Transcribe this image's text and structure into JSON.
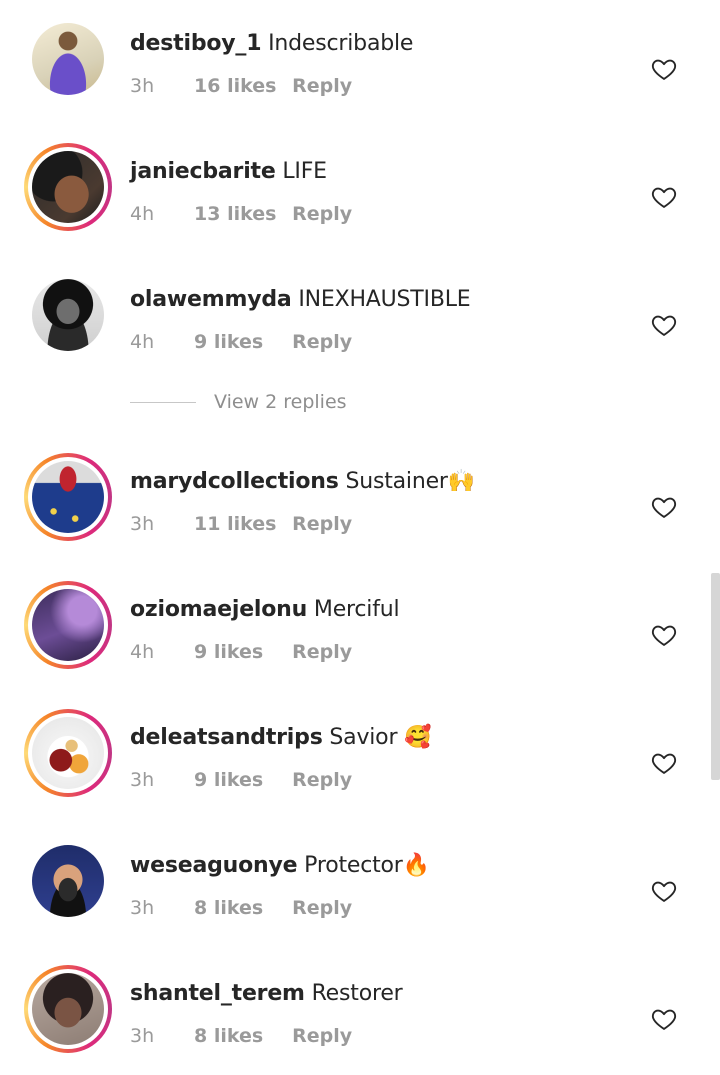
{
  "comments": [
    {
      "username": "destiboy_1",
      "text": "Indescribable",
      "time": "3h",
      "likes": "16 likes",
      "reply": "Reply",
      "avatar": "portrait-man-purple-shirt",
      "story": false
    },
    {
      "username": "janiecbarite",
      "text": "LIFE",
      "time": "4h",
      "likes": "13 likes",
      "reply": "Reply",
      "avatar": "portrait-woman-curly-hair",
      "story": true
    },
    {
      "username": "olawemmyda",
      "text": "INEXHAUSTIBLE",
      "time": "4h",
      "likes": "9 likes",
      "reply": "Reply",
      "avatar": "portrait-woman-bw",
      "story": false
    },
    {
      "username": "marydcollections",
      "text": "Sustainer🙌",
      "time": "3h",
      "likes": "11 likes",
      "reply": "Reply",
      "avatar": "bedding-photo",
      "story": true
    },
    {
      "username": "oziomaejelonu",
      "text": "Merciful",
      "time": "4h",
      "likes": "9 likes",
      "reply": "Reply",
      "avatar": "purple-gradient",
      "story": true
    },
    {
      "username": "deleatsandtrips",
      "text": "Savior 🥰",
      "time": "3h",
      "likes": "9 likes",
      "reply": "Reply",
      "avatar": "food-plate",
      "story": true
    },
    {
      "username": "weseaguonye",
      "text": "Protector🔥",
      "time": "3h",
      "likes": "8 likes",
      "reply": "Reply",
      "avatar": "bearded-man-glasses",
      "story": false
    },
    {
      "username": "shantel_terem",
      "text": "Restorer",
      "time": "3h",
      "likes": "8 likes",
      "reply": "Reply",
      "avatar": "portrait-woman-selfie",
      "story": true
    }
  ],
  "view_replies": "View 2 replies",
  "colors": {
    "meta_text": "#9a9a9a",
    "username": "#262626",
    "story_ring_start": "#f58529",
    "story_ring_end": "#dd2a7b",
    "scrollbar": "#d6d6d6"
  },
  "icons": {
    "like": "heart-outline-icon"
  }
}
